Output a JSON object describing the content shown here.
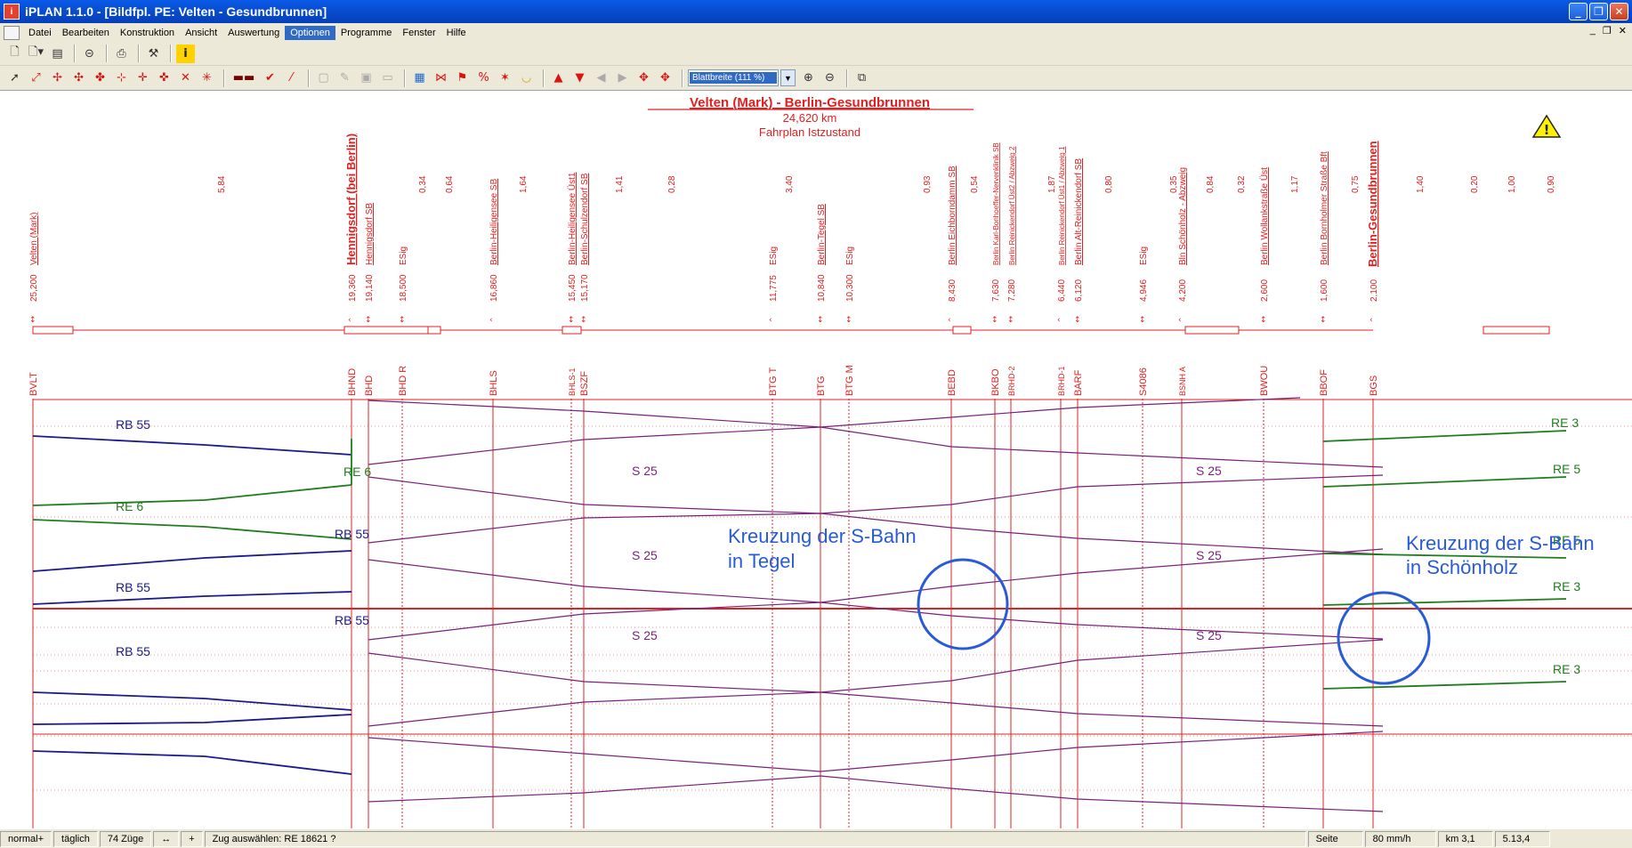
{
  "window": {
    "title": "iPLAN 1.1.0 - [Bildfpl. PE: Velten - Gesundbrunnen]",
    "minimize": "_",
    "restore": "❐",
    "close": "✕"
  },
  "menu": {
    "items": [
      "Datei",
      "Bearbeiten",
      "Konstruktion",
      "Ansicht",
      "Auswertung",
      "Optionen",
      "Programme",
      "Fenster",
      "Hilfe"
    ],
    "active": "Optionen",
    "mdi": [
      "_",
      "❐",
      "✕"
    ]
  },
  "toolbar": {
    "zoom": "Blattbreite (111 %)"
  },
  "header": {
    "title": "Velten (Mark) - Berlin-Gesundbrunnen",
    "distance": "24,620 km",
    "subtitle": "Fahrplan Istzustand"
  },
  "stations": [
    {
      "km": "25,200",
      "name": "Velten (Mark)",
      "code": "BVLT"
    },
    {
      "km": "19,360",
      "name": "Hennigsdorf (bei Berlin)",
      "code": "BHND"
    },
    {
      "km": "19,140",
      "name": "Hennigsdorf SB",
      "code": "BHD"
    },
    {
      "km": "18,500",
      "name": "ESig",
      "code": "BHD R"
    },
    {
      "km": "16,860",
      "name": "Berlin-Heiligensee SB",
      "code": "BHLS"
    },
    {
      "km": "15,450",
      "name": "Berlin-Heiligensee Üst1",
      "code": "BHLS-1"
    },
    {
      "km": "15,170",
      "name": "Berlin-Schulzendorf SB",
      "code": "BSZF"
    },
    {
      "km": "11,775",
      "name": "ESig",
      "code": "BTG T"
    },
    {
      "km": "10,840",
      "name": "Berlin-Tegel SB",
      "code": "BTG"
    },
    {
      "km": "10,300",
      "name": "ESig",
      "code": "BTG M"
    },
    {
      "km": "8,430",
      "name": "Berlin Eichborndamm SB",
      "code": "BEBD"
    },
    {
      "km": "7,630",
      "name": "Berlin Karl-Bonhoeffer-Nervenklinik SB",
      "code": "BKBO"
    },
    {
      "km": "7,280",
      "name": "Berlin Reinickendorf Üst2 / Abzweig 2",
      "code": "BRHD-2"
    },
    {
      "km": "6,440",
      "name": "Berlin Reinickendorf Üst1 / Abzweig 1",
      "code": "BRHD-1"
    },
    {
      "km": "6,120",
      "name": "Berlin Alt-Reinickendorf SB",
      "code": "BARF"
    },
    {
      "km": "4,946",
      "name": "ESig",
      "code": "S4086"
    },
    {
      "km": "4,200",
      "name": "Bln Schönholz - Abzweig",
      "code": "BSNH A"
    },
    {
      "km": "2,600",
      "name": "Berlin Wollankstraße Üst",
      "code": "BWOU"
    },
    {
      "km": "1,600",
      "name": "Berlin Bornholmer Straße Bft",
      "code": "BBOF"
    },
    {
      "km": "2,100",
      "name": "Berlin-Gesundbrunnen",
      "code": "BGS"
    }
  ],
  "segment_distances": [
    "5,84",
    "0,34",
    "0,64",
    "1,64",
    "1,41",
    "0,28",
    "3,40",
    "0,93",
    "0,54",
    "1,87",
    "0,80",
    "0,35",
    "0,84",
    "0,32",
    "1,17",
    "0,75",
    "1,40",
    "0,20",
    "1,00",
    "0,90"
  ],
  "train_labels": [
    {
      "text": "RB 55",
      "color": "#1a1a8c"
    },
    {
      "text": "RE 6",
      "color": "#1e7d1e"
    },
    {
      "text": "RE 6",
      "color": "#1e7d1e"
    },
    {
      "text": "RB 55",
      "color": "#1a1a8c"
    },
    {
      "text": "RB 55",
      "color": "#1a1a8c"
    },
    {
      "text": "RB 55",
      "color": "#1a1a8c"
    },
    {
      "text": "RB 55",
      "color": "#1a1a8c"
    },
    {
      "text": "S 25",
      "color": "#7a1f7a"
    },
    {
      "text": "S 25",
      "color": "#7a1f7a"
    },
    {
      "text": "S 25",
      "color": "#7a1f7a"
    },
    {
      "text": "S 25",
      "color": "#7a1f7a"
    },
    {
      "text": "S 25",
      "color": "#7a1f7a"
    },
    {
      "text": "S 25",
      "color": "#7a1f7a"
    },
    {
      "text": "RE 3",
      "color": "#1e7d1e"
    },
    {
      "text": "RE 5",
      "color": "#1e7d1e"
    },
    {
      "text": "RE 5",
      "color": "#1e7d1e"
    },
    {
      "text": "RE 3",
      "color": "#1e7d1e"
    },
    {
      "text": "RE 3",
      "color": "#1e7d1e"
    }
  ],
  "annotations": [
    {
      "line1": "Kreuzung der S-Bahn",
      "line2": "in Tegel"
    },
    {
      "line1": "Kreuzung der S-Bahn",
      "line2": "in Schönholz"
    }
  ],
  "colors": {
    "grid": "#e02020",
    "sbahn": "#7a1f7a",
    "rb": "#1a1a8c",
    "re": "#1e7d1e",
    "annotation": "#2a5bd7"
  },
  "status": {
    "mode": "normal+",
    "days": "täglich",
    "trains": "74 Züge",
    "arrows": "↔",
    "plus": "+",
    "message": "Zug auswählen: RE 18621 ?",
    "page": "Seite",
    "speed": "80 mm/h",
    "km": "km 3,1",
    "time": "5.13,4"
  }
}
